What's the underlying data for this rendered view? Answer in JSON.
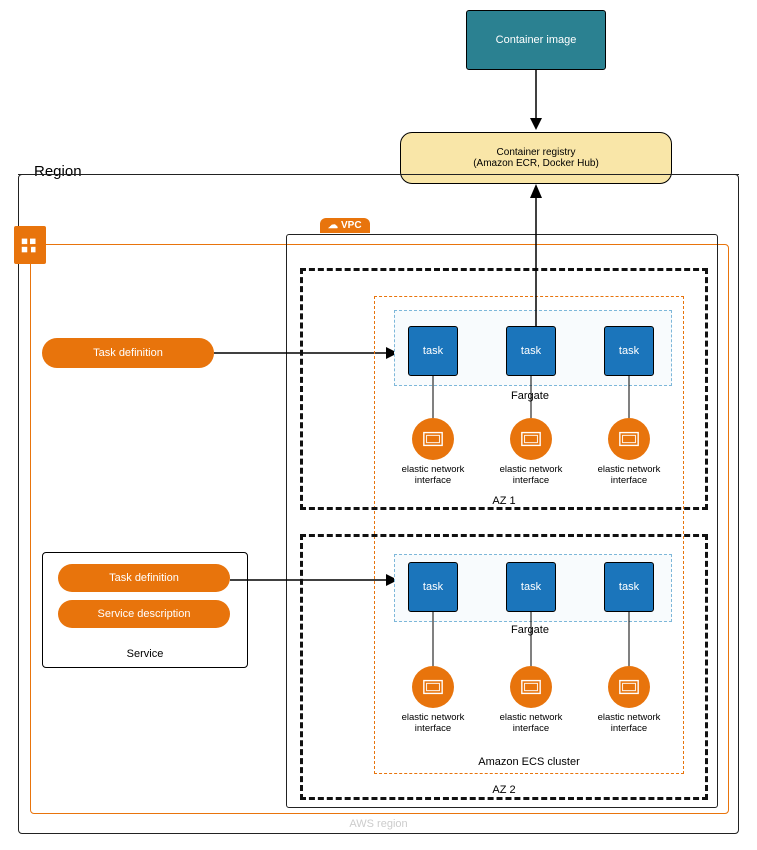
{
  "container_image": {
    "label": "Container image"
  },
  "container_registry": {
    "line1": "Container registry",
    "line2": "(Amazon ECR, Docker Hub)"
  },
  "region_label": "Region",
  "vpc_label": "VPC",
  "task_definition_1": "Task definition",
  "service": {
    "task_definition": "Task definition",
    "service_description": "Service description",
    "label": "Service"
  },
  "fargate_label": "Fargate",
  "task_label": "task",
  "eni_label": "elastic network interface",
  "cluster_label": "Amazon ECS cluster",
  "az1_label": "AZ 1",
  "az2_label": "AZ 2",
  "aws_region_label": "AWS region"
}
